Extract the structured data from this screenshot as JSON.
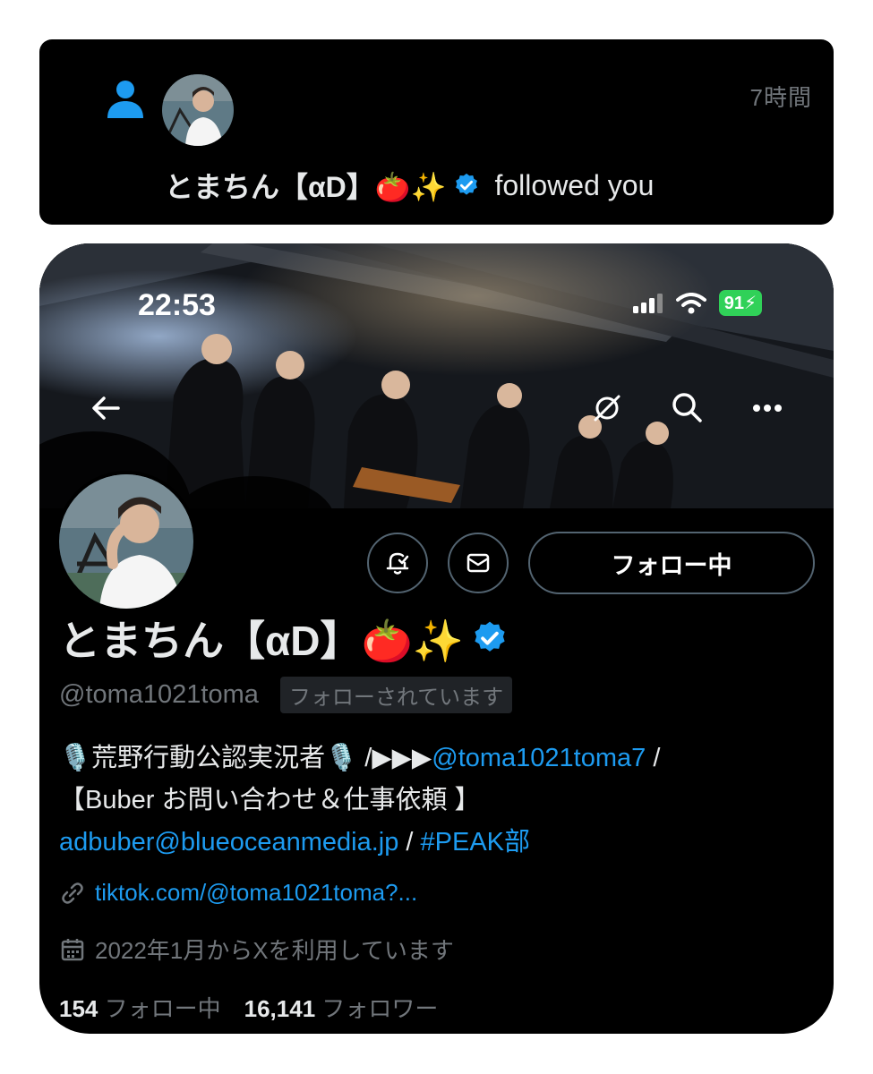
{
  "notification": {
    "time": "7時間",
    "name": "とまちん【αD】🍅✨",
    "action": "followed you"
  },
  "status_bar": {
    "time": "22:53",
    "battery": "91"
  },
  "profile": {
    "display_name": "とまちん【αD】🍅✨",
    "handle": "@toma1021toma",
    "follows_you": "フォローされています",
    "follow_button": "フォロー中",
    "bio": {
      "line1_prefix": "🎙️荒野行動公認実況者🎙️ /▶▶▶",
      "line1_mention": "@toma1021toma7",
      "line1_suffix": " /",
      "line2": "【Buber お問い合わせ＆仕事依頼 】",
      "line3_email": "adbuber@blueoceanmedia.jp",
      "line3_sep": " / ",
      "line3_hashtag": "#PEAK部"
    },
    "link": "tiktok.com/@toma1021toma?...",
    "joined": "2022年1月からXを利用しています",
    "following_count": "154",
    "following_label": "フォロー中",
    "followers_count": "16,141",
    "followers_label": "フォロワー"
  },
  "colors": {
    "accent": "#1d9bf0",
    "background": "#000000",
    "muted": "#71767b"
  }
}
